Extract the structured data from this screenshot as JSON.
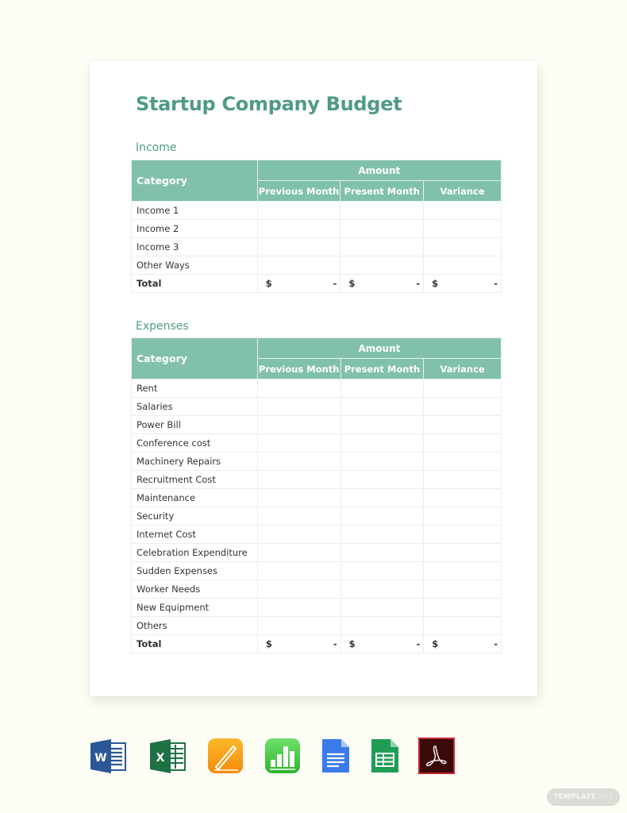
{
  "document": {
    "title": "Startup Company Budget",
    "accent_color": "#4f9a86",
    "header_color": "#81c0ad"
  },
  "income": {
    "section_title": "Income",
    "headers": {
      "category": "Category",
      "amount": "Amount",
      "columns": [
        "Previous Month",
        "Present Month",
        "Variance"
      ]
    },
    "rows": [
      {
        "category": "Income 1",
        "values": [
          "",
          "",
          ""
        ]
      },
      {
        "category": "Income 2",
        "values": [
          "",
          "",
          ""
        ]
      },
      {
        "category": "Income 3",
        "values": [
          "",
          "",
          ""
        ]
      },
      {
        "category": "Other Ways",
        "values": [
          "",
          "",
          ""
        ]
      }
    ],
    "total": {
      "label": "Total",
      "values": [
        {
          "currency": "$",
          "amount": "-"
        },
        {
          "currency": "$",
          "amount": "-"
        },
        {
          "currency": "$",
          "amount": "-"
        }
      ]
    }
  },
  "expenses": {
    "section_title": "Expenses",
    "headers": {
      "category": "Category",
      "amount": "Amount",
      "columns": [
        "Previous Month",
        "Present Month",
        "Variance"
      ]
    },
    "rows": [
      {
        "category": "Rent",
        "values": [
          "",
          "",
          ""
        ]
      },
      {
        "category": "Salaries",
        "values": [
          "",
          "",
          ""
        ]
      },
      {
        "category": "Power Bill",
        "values": [
          "",
          "",
          ""
        ]
      },
      {
        "category": "Conference cost",
        "values": [
          "",
          "",
          ""
        ]
      },
      {
        "category": "Machinery Repairs",
        "values": [
          "",
          "",
          ""
        ]
      },
      {
        "category": "Recruitment Cost",
        "values": [
          "",
          "",
          ""
        ]
      },
      {
        "category": "Maintenance",
        "values": [
          "",
          "",
          ""
        ]
      },
      {
        "category": "Security",
        "values": [
          "",
          "",
          ""
        ]
      },
      {
        "category": "Internet Cost",
        "values": [
          "",
          "",
          ""
        ]
      },
      {
        "category": "Celebration Expenditure",
        "values": [
          "",
          "",
          ""
        ]
      },
      {
        "category": "Sudden Expenses",
        "values": [
          "",
          "",
          ""
        ]
      },
      {
        "category": "Worker Needs",
        "values": [
          "",
          "",
          ""
        ]
      },
      {
        "category": "New Equipment",
        "values": [
          "",
          "",
          ""
        ]
      },
      {
        "category": "Others",
        "values": [
          "",
          "",
          ""
        ]
      }
    ],
    "total": {
      "label": "Total",
      "values": [
        {
          "currency": "$",
          "amount": "-"
        },
        {
          "currency": "$",
          "amount": "-"
        },
        {
          "currency": "$",
          "amount": "-"
        }
      ]
    }
  },
  "format_icons": [
    {
      "name": "microsoft-word",
      "icon": "word-icon",
      "letter": "W",
      "color": "#2b5797"
    },
    {
      "name": "microsoft-excel",
      "icon": "excel-icon",
      "letter": "X",
      "color": "#1e7145"
    },
    {
      "name": "apple-pages",
      "icon": "pages-icon",
      "color": "#f7a11a"
    },
    {
      "name": "apple-numbers",
      "icon": "numbers-icon",
      "color": "#3fcb3f"
    },
    {
      "name": "google-docs",
      "icon": "google-docs-icon",
      "color": "#3b7be8"
    },
    {
      "name": "google-sheets",
      "icon": "google-sheets-icon",
      "color": "#1f9d55"
    },
    {
      "name": "adobe-pdf",
      "icon": "pdf-icon",
      "color": "#3a0a0a"
    }
  ],
  "watermark": {
    "brand": "TEMPLATE",
    "suffix": ".NET"
  }
}
